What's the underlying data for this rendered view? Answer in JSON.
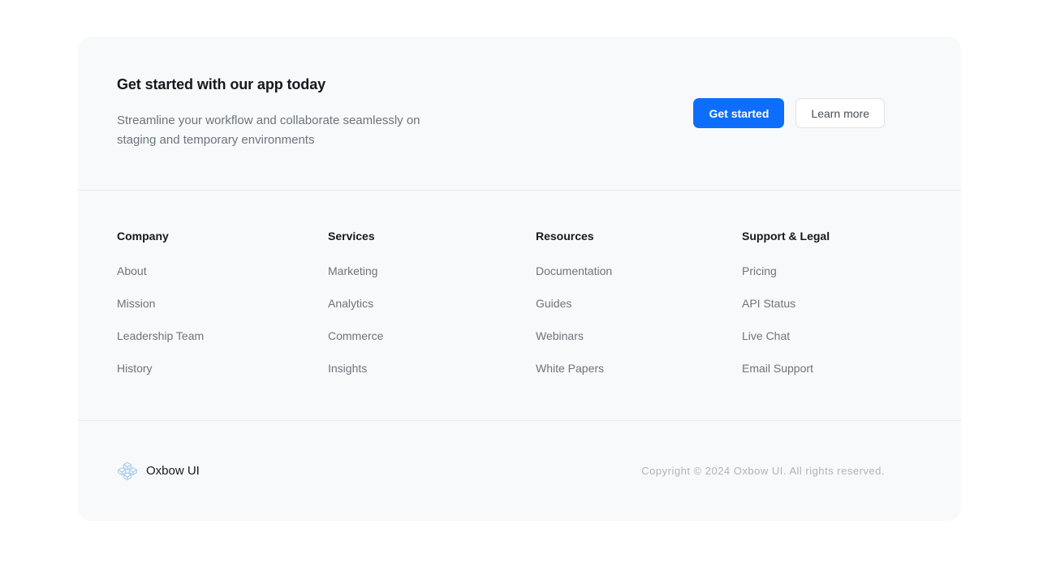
{
  "cta": {
    "title": "Get started with our app today",
    "subtitle": "Streamline your workflow and collaborate seamlessly on staging and temporary environments",
    "primary_button": "Get started",
    "secondary_button": "Learn more",
    "primary_color": "#0d6efd"
  },
  "link_columns": [
    {
      "title": "Company",
      "links": [
        "About",
        "Mission",
        "Leadership Team",
        "History"
      ]
    },
    {
      "title": "Services",
      "links": [
        "Marketing",
        "Analytics",
        "Commerce",
        "Insights"
      ]
    },
    {
      "title": "Resources",
      "links": [
        "Documentation",
        "Guides",
        "Webinars",
        "White Papers"
      ]
    },
    {
      "title": "Support & Legal",
      "links": [
        "Pricing",
        "API Status",
        "Live Chat",
        "Email Support"
      ]
    }
  ],
  "brand": {
    "name": "Oxbow UI",
    "logo_icon": "isometric-cube-cluster-icon",
    "logo_color": "#a9cdf3"
  },
  "copyright": "Copyright © 2024 Oxbow UI. All rights reserved."
}
